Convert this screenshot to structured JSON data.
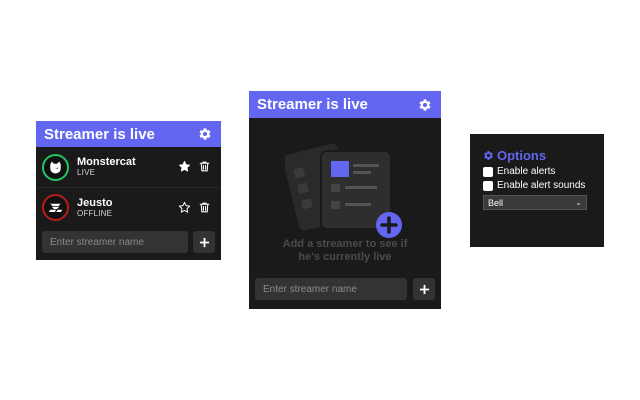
{
  "panel_list": {
    "header_title": "Streamer is live",
    "streamers": [
      {
        "name": "Monstercat",
        "status": "LIVE",
        "favorited": true
      },
      {
        "name": "Jeusto",
        "status": "OFFLINE",
        "favorited": false
      }
    ],
    "input_placeholder": "Enter streamer name"
  },
  "panel_empty": {
    "header_title": "Streamer is live",
    "empty_line1": "Add a streamer to see if",
    "empty_line2": "he's currently live",
    "input_placeholder": "Enter streamer name"
  },
  "panel_options": {
    "title": "Options",
    "enable_alerts_label": "Enable alerts",
    "enable_alert_sounds_label": "Enable alert sounds",
    "sound_selected": "Bell"
  },
  "colors": {
    "accent": "#6366f1",
    "panel_bg": "#1a1a1a",
    "live": "#22c55e",
    "offline": "#b91c1c"
  },
  "icons": [
    "gear-icon",
    "star-icon",
    "trash-icon",
    "plus-icon",
    "monstercat-logo",
    "jeusto-logo",
    "streamer-list-illustration",
    "chevron-down-icon"
  ]
}
